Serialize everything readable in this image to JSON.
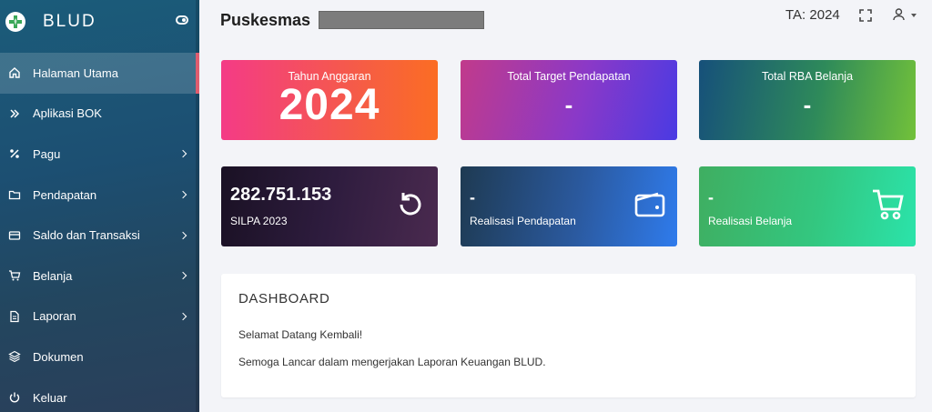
{
  "brand": {
    "name": "BLUD",
    "logo_icon": "plus-leaf-logo-icon"
  },
  "sidebar": {
    "items": [
      {
        "label": "Halaman Utama",
        "icon": "home-icon",
        "active": true,
        "has_children": false
      },
      {
        "label": "Aplikasi BOK",
        "icon": "double-chevron-icon",
        "active": false,
        "has_children": false
      },
      {
        "label": "Pagu",
        "icon": "percent-icon",
        "active": false,
        "has_children": true
      },
      {
        "label": "Pendapatan",
        "icon": "folder-icon",
        "active": false,
        "has_children": true
      },
      {
        "label": "Saldo dan Transaksi",
        "icon": "credit-card-icon",
        "active": false,
        "has_children": true
      },
      {
        "label": "Belanja",
        "icon": "cart-icon",
        "active": false,
        "has_children": true
      },
      {
        "label": "Laporan",
        "icon": "document-icon",
        "active": false,
        "has_children": true
      },
      {
        "label": "Dokumen",
        "icon": "layers-icon",
        "active": false,
        "has_children": false
      },
      {
        "label": "Keluar",
        "icon": "power-icon",
        "active": false,
        "has_children": false
      }
    ]
  },
  "header": {
    "title": "Puskesmas",
    "fiscal_year": "TA: 2024"
  },
  "cards": [
    {
      "label": "Tahun Anggaran",
      "value": "2024"
    },
    {
      "label": "Total Target Pendapatan",
      "value": "-"
    },
    {
      "label": "Total RBA Belanja",
      "value": "-"
    },
    {
      "label": "SILPA 2023",
      "value": "282.751.153",
      "icon": "history-icon"
    },
    {
      "label": "Realisasi Pendapatan",
      "value": "-",
      "icon": "wallet-icon"
    },
    {
      "label": "Realisasi Belanja",
      "value": "-",
      "icon": "cart-icon"
    }
  ],
  "dashboard": {
    "title": "DASHBOARD",
    "line1": "Selamat Datang Kembali!",
    "line2": "Semoga Lancar dalam mengerjakan Laporan Keuangan BLUD."
  },
  "colors": {
    "active_indicator": "#e05d6f",
    "page_bg": "#f3f4f8"
  }
}
